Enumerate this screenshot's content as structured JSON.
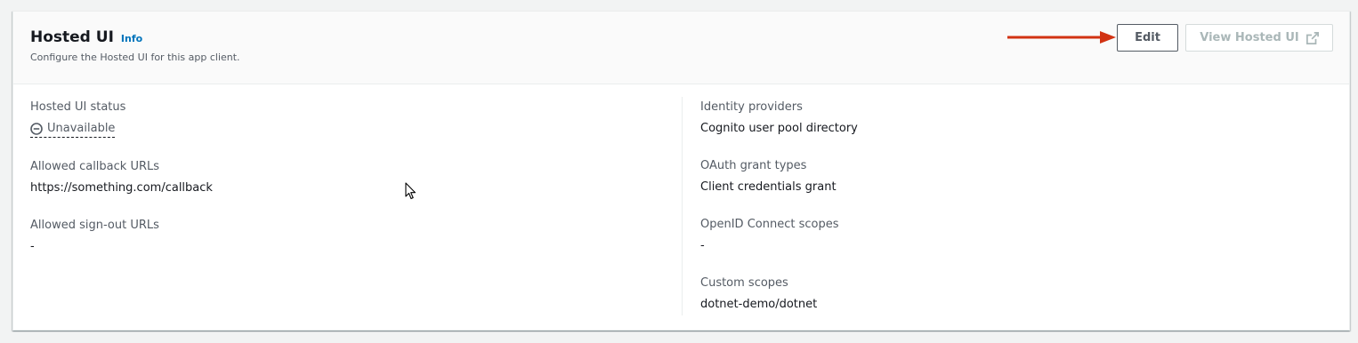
{
  "header": {
    "title": "Hosted UI",
    "info_label": "Info",
    "description": "Configure the Hosted UI for this app client.",
    "edit_label": "Edit",
    "view_hosted_ui_label": "View Hosted UI"
  },
  "left": {
    "status_label": "Hosted UI status",
    "status_value": "Unavailable",
    "callback_label": "Allowed callback URLs",
    "callback_value": "https://something.com/callback",
    "signout_label": "Allowed sign-out URLs",
    "signout_value": "-"
  },
  "right": {
    "idp_label": "Identity providers",
    "idp_value": "Cognito user pool directory",
    "oauth_label": "OAuth grant types",
    "oauth_value": "Client credentials grant",
    "oidc_label": "OpenID Connect scopes",
    "oidc_value": "-",
    "custom_label": "Custom scopes",
    "custom_value": "dotnet-demo/dotnet"
  },
  "colors": {
    "accent_link": "#0073bb",
    "annotation_arrow": "#d13212"
  },
  "icons": [
    "status-unavailable-icon",
    "external-link-icon",
    "annotation-arrow",
    "mouse-cursor-icon"
  ]
}
